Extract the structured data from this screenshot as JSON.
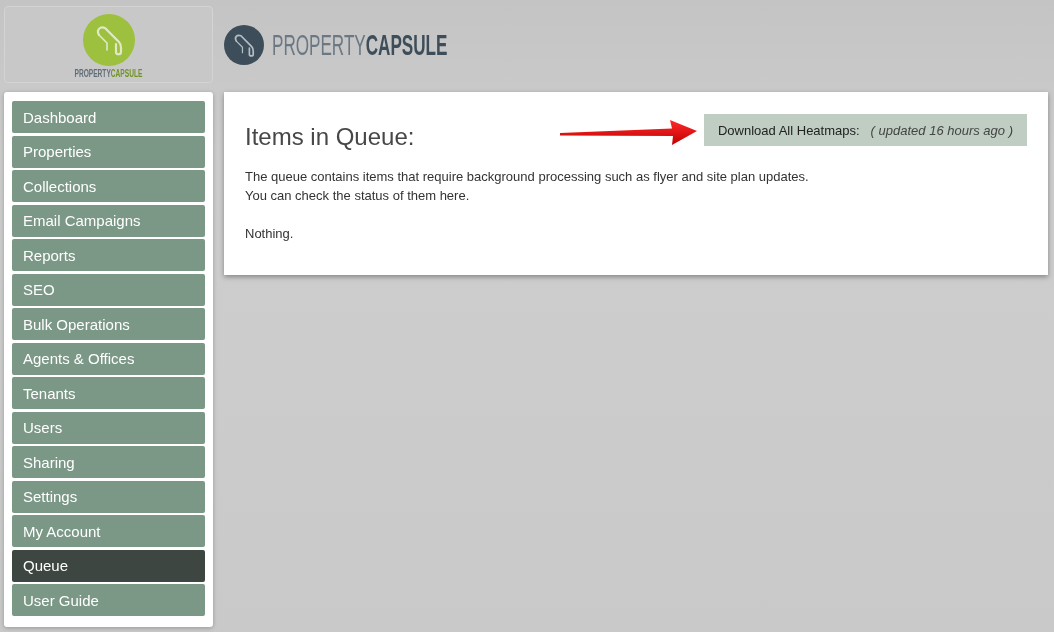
{
  "logo_card": {
    "text_parts": [
      "PROPERTY",
      "CAPSULE"
    ]
  },
  "header_logo": {
    "text_parts": [
      "PROPERTY",
      "CAPSULE"
    ]
  },
  "sidebar": {
    "items": [
      {
        "label": "Dashboard",
        "selected": false
      },
      {
        "label": "Properties",
        "selected": false
      },
      {
        "label": "Collections",
        "selected": false
      },
      {
        "label": "Email Campaigns",
        "selected": false
      },
      {
        "label": "Reports",
        "selected": false
      },
      {
        "label": "SEO",
        "selected": false
      },
      {
        "label": "Bulk Operations",
        "selected": false
      },
      {
        "label": "Agents & Offices",
        "selected": false
      },
      {
        "label": "Tenants",
        "selected": false
      },
      {
        "label": "Users",
        "selected": false
      },
      {
        "label": "Sharing",
        "selected": false
      },
      {
        "label": "Settings",
        "selected": false
      },
      {
        "label": "My Account",
        "selected": false
      },
      {
        "label": "Queue",
        "selected": true
      },
      {
        "label": "User Guide",
        "selected": false
      }
    ]
  },
  "main": {
    "title": "Items in Queue:",
    "download_button": {
      "label": "Download All Heatmaps:",
      "note": "( updated 16 hours ago )"
    },
    "description": [
      "The queue contains items that require background processing such as flyer and site plan updates.",
      "You can check the status of them here."
    ],
    "empty_message": "Nothing."
  }
}
